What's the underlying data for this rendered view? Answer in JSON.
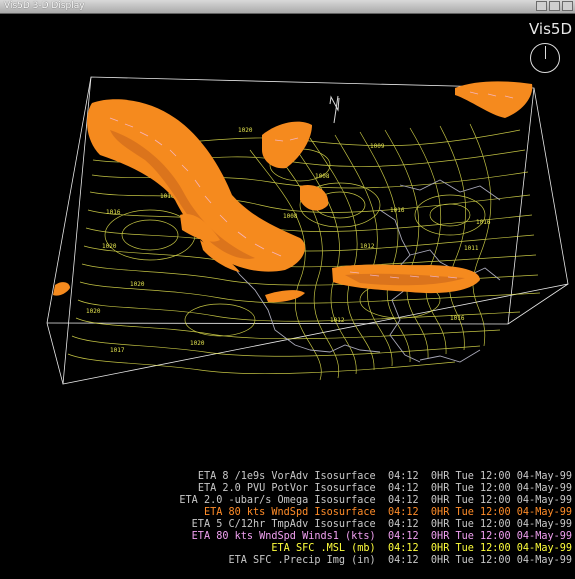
{
  "window": {
    "title": "Vis5D 3-D Display"
  },
  "logo": "Vis5D",
  "map_labels": {
    "north": "N",
    "isobars": [
      "1016",
      "1020",
      "1020",
      "1020",
      "1020",
      "1017",
      "1012",
      "1016",
      "1008",
      "1016",
      "1020",
      "1016",
      "1012",
      "1008",
      "1011",
      "1013",
      "1016",
      "1009"
    ]
  },
  "colors": {
    "isosurface": "#f58a1e",
    "contour": "#e6e650",
    "box": "#e8e8e8"
  },
  "legend": [
    {
      "label": "ETA 8 /1e9s VorAdv Isosurface",
      "time": "04:12",
      "date": "0HR Tue 12:00 04-May-99",
      "color": "#c8c8c8"
    },
    {
      "label": "ETA 2.0 PVU PotVor Isosurface",
      "time": "04:12",
      "date": "0HR Tue 12:00 04-May-99",
      "color": "#c8c8c8"
    },
    {
      "label": "ETA 2.0 -ubar/s Omega Isosurface",
      "time": "04:12",
      "date": "0HR Tue 12:00 04-May-99",
      "color": "#c8c8c8"
    },
    {
      "label": "ETA 80 kts WndSpd Isosurface",
      "time": "04:12",
      "date": "0HR Tue 12:00 04-May-99",
      "color": "#ff8c28"
    },
    {
      "label": "ETA 5 C/12hr TmpAdv Isosurface",
      "time": "04:12",
      "date": "0HR Tue 12:00 04-May-99",
      "color": "#c8c8c8"
    },
    {
      "label": "ETA 80 kts WndSpd Winds1 (kts)",
      "time": "04:12",
      "date": "0HR Tue 12:00 04-May-99",
      "color": "#f0a0f0"
    },
    {
      "label": "ETA SFC .MSL (mb)",
      "time": "04:12",
      "date": "0HR Tue 12:00 04-May-99",
      "color": "#ffff3c"
    },
    {
      "label": "ETA SFC .Precip Img (in)",
      "time": "04:12",
      "date": "0HR Tue 12:00 04-May-99",
      "color": "#c8c8c8"
    }
  ]
}
